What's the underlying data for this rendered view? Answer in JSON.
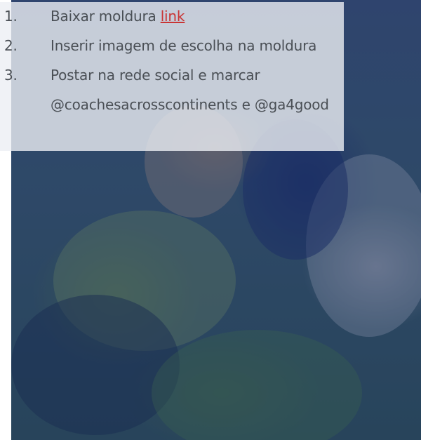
{
  "steps": [
    {
      "number": "1.",
      "text": "Baixar moldura ",
      "link": "link"
    },
    {
      "number": "2.",
      "text": "Inserir imagem de escolha na moldura"
    },
    {
      "number": "3.",
      "text": "Postar na rede social e marcar",
      "continuation": "@coachesacrosscontinents e @ga4good"
    }
  ],
  "colors": {
    "link": "#c93535",
    "text": "#4a4f55",
    "photo_tint": "#1e3a6e",
    "overlay": "#eceff4"
  },
  "image": {
    "description_icon": "group-photo-image"
  }
}
